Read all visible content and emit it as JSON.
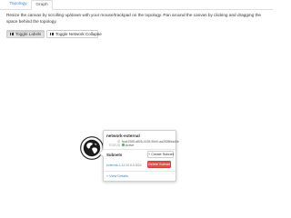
{
  "tabs": [
    {
      "label": "Topology",
      "active": false
    },
    {
      "label": "Graph",
      "active": true
    }
  ],
  "instructions": "Resize the canvas by scrolling up/down with your mouse/trackpad on the topology. Pan around the canvas by clicking and dragging the space behind the topology.",
  "toolbar": {
    "toggle_labels_label": "Toggle Labels",
    "toggle_collapse_label": "Toggle Network Collapse"
  },
  "node": {
    "icon": "globe-icon"
  },
  "popup": {
    "title": "network-external",
    "id_key": "ID",
    "id_value": "feca7065-a825-4139-90e0-aa2528fda44e",
    "status_key": "STATUS",
    "status_value": "Active",
    "subnets_heading": "Subnets",
    "create_subnet_label": "+ Create Subnet",
    "subnets": [
      {
        "name": "external-1-11",
        "cidr": "10.0.0.0/24",
        "delete_label": "Delete Subnet"
      }
    ],
    "view_details_label": "» View Details"
  },
  "colors": {
    "link": "#3a87c8",
    "danger": "#d9534f",
    "active": "#5cb85c"
  }
}
